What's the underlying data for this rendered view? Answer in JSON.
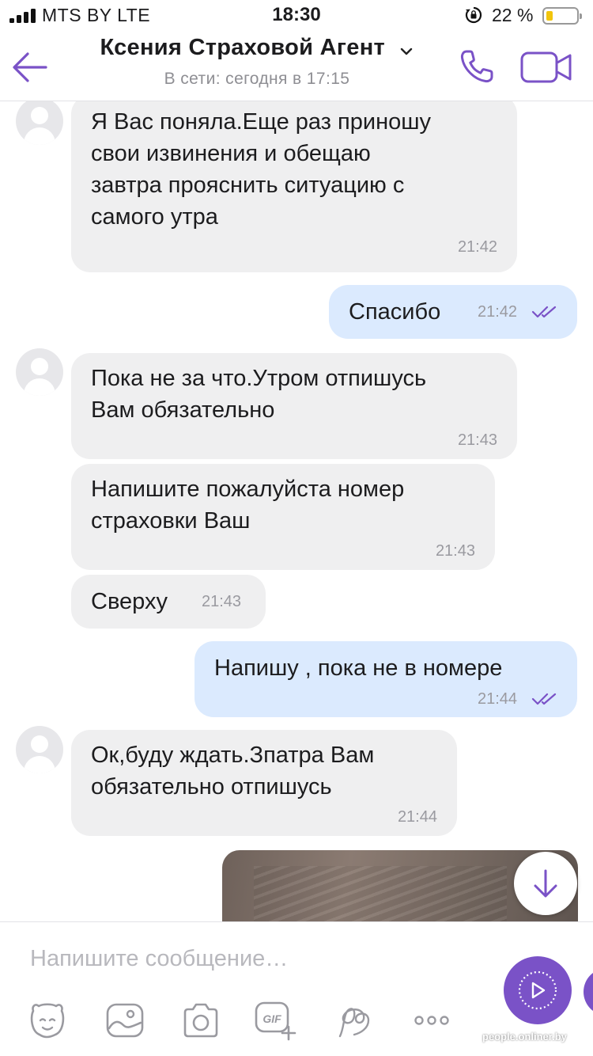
{
  "status_bar": {
    "carrier": "MTS BY   LTE",
    "time": "18:30",
    "battery_text": "22 %",
    "battery_level": 0.22,
    "battery_color": "#f2c50c"
  },
  "header": {
    "title": "Ксения Страховой Агент",
    "subtitle": "В сети: сегодня в 17:15",
    "back_icon": "arrow-left-icon",
    "call_icon": "phone-icon",
    "video_icon": "video-camera-icon",
    "accent_color": "#7a52c7"
  },
  "messages": [
    {
      "dir": "in",
      "lines": [
        "Я Вас поняла.Еще раз приношу",
        "свои извинения и обещаю",
        "завтра прояснить ситуацию с",
        "самого утра"
      ],
      "time": "21:42"
    },
    {
      "dir": "out",
      "lines": [
        "Спасибо"
      ],
      "time": "21:42",
      "status": "read"
    },
    {
      "dir": "in",
      "lines": [
        "Пока не за что.Утром отпишусь",
        "Вам обязательно"
      ],
      "time": "21:43"
    },
    {
      "dir": "in",
      "lines": [
        "Напишите пожалуйста номер",
        "страховки Ваш"
      ],
      "time": "21:43"
    },
    {
      "dir": "in",
      "lines": [
        "Сверху"
      ],
      "time": "21:43"
    },
    {
      "dir": "out",
      "lines": [
        "Напишу , пока не в номере"
      ],
      "time": "21:44",
      "status": "read"
    },
    {
      "dir": "in",
      "lines": [
        "Ок,буду ждать.Зпатра Вам",
        "обязательно отпишусь"
      ],
      "time": "21:44"
    }
  ],
  "input": {
    "placeholder": "Напишите сообщение…",
    "value": ""
  },
  "toolbar": {
    "items": [
      "sticker-icon",
      "gallery-icon",
      "camera-icon",
      "gif-icon",
      "doodle-icon",
      "more-icon"
    ]
  },
  "watermark": "people.onliner.by"
}
